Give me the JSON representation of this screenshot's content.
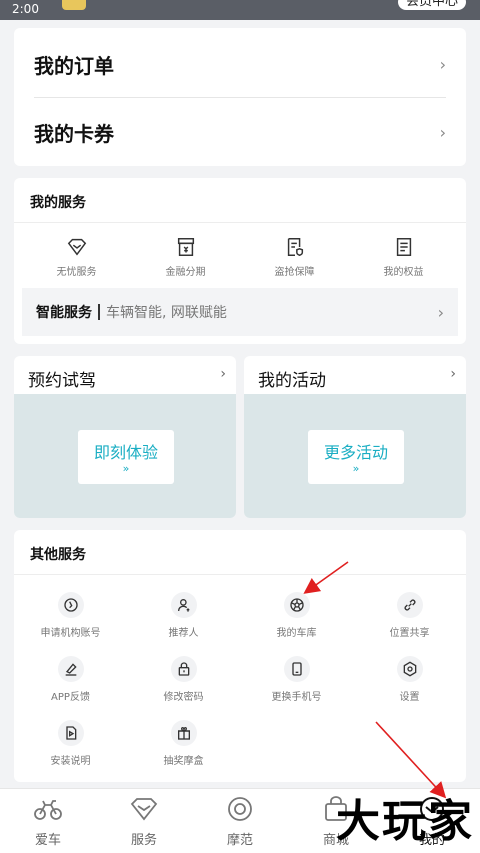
{
  "status_bar": {
    "time": "2:00",
    "member_label": "会员中心"
  },
  "orders": {
    "my_orders": "我的订单",
    "my_coupons": "我的卡券"
  },
  "my_services": {
    "title": "我的服务",
    "items": [
      {
        "label": "无忧服务",
        "icon": "diamond-icon"
      },
      {
        "label": "金融分期",
        "icon": "finance-icon"
      },
      {
        "label": "盗抢保障",
        "icon": "shield-doc-icon"
      },
      {
        "label": "我的权益",
        "icon": "benefit-doc-icon"
      }
    ],
    "smart": {
      "title": "智能服务",
      "subtitle": "车辆智能, 网联赋能"
    }
  },
  "test_drive": {
    "title": "预约试驾",
    "button": "即刻体验",
    "arrow": "»"
  },
  "activities": {
    "title": "我的活动",
    "button": "更多活动",
    "arrow": "»"
  },
  "other_services": {
    "title": "其他服务",
    "items": [
      {
        "label": "申请机构账号",
        "icon": "clock-icon"
      },
      {
        "label": "推荐人",
        "icon": "person-icon"
      },
      {
        "label": "我的车库",
        "icon": "wheel-icon"
      },
      {
        "label": "位置共享",
        "icon": "link-icon"
      },
      {
        "label": "APP反馈",
        "icon": "feedback-icon"
      },
      {
        "label": "修改密码",
        "icon": "lock-icon"
      },
      {
        "label": "更换手机号",
        "icon": "phone-icon"
      },
      {
        "label": "设置",
        "icon": "gear-icon"
      },
      {
        "label": "安装说明",
        "icon": "play-doc-icon"
      },
      {
        "label": "抽奖摩盒",
        "icon": "gift-icon"
      }
    ]
  },
  "tabs": [
    {
      "label": "爱车",
      "icon": "motorcycle-icon"
    },
    {
      "label": "服务",
      "icon": "diamond-icon"
    },
    {
      "label": "摩范",
      "icon": "target-icon"
    },
    {
      "label": "商城",
      "icon": "bag-icon"
    },
    {
      "label": "我的",
      "icon": "profile-icon",
      "active": true
    }
  ],
  "watermark": "大玩家",
  "colors": {
    "accent": "#1aaec3",
    "background": "#f2f3f5",
    "annotation": "#e02020"
  }
}
